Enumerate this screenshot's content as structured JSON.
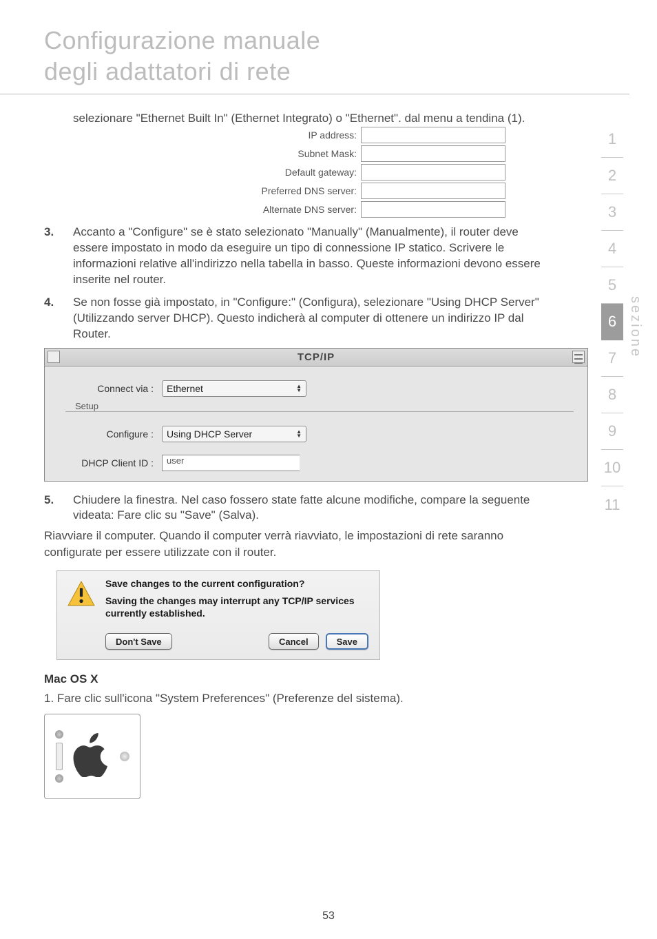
{
  "header": {
    "title_line1": "Configurazione manuale",
    "title_line2": "degli adattatori di rete"
  },
  "intro_paragraph": "selezionare \"Ethernet Built In\" (Ethernet Integrato) o \"Ethernet\". dal menu a tendina (1).",
  "ip_fields": {
    "ip_address": "IP address:",
    "subnet_mask": "Subnet Mask:",
    "default_gateway": "Default gateway:",
    "preferred_dns": "Preferred DNS server:",
    "alternate_dns": "Alternate DNS server:"
  },
  "step3": {
    "num": "3.",
    "text": "Accanto a \"Configure\" se è stato selezionato \"Manually\" (Manualmente), il router deve essere impostato in modo da eseguire un tipo di connessione IP statico. Scrivere le informazioni relative all'indirizzo nella tabella in basso. Queste informazioni devono essere inserite nel router."
  },
  "step4": {
    "num": "4.",
    "text": "Se non fosse già impostato, in \"Configure:\" (Configura), selezionare \"Using DHCP Server\" (Utilizzando server DHCP). Questo indicherà al computer di ottenere un indirizzo IP dal Router."
  },
  "tcpip": {
    "title": "TCP/IP",
    "setup_label": "Setup",
    "connect_via_label": "Connect via :",
    "connect_via_value": "Ethernet",
    "configure_label": "Configure :",
    "configure_value": "Using DHCP Server",
    "dhcp_client_id_label": "DHCP Client ID :",
    "dhcp_client_id_value": "user"
  },
  "step5": {
    "num": "5.",
    "text": "Chiudere la finestra. Nel caso fossero state fatte alcune modifiche, compare la seguente videata: Fare clic su \"Save\" (Salva)."
  },
  "restart_para": "Riavviare il computer. Quando il computer verrà riavviato, le impostazioni di rete saranno configurate per essere utilizzate con il router.",
  "dialog": {
    "line1": "Save changes to the current configuration?",
    "line2": "Saving the changes may interrupt any TCP/IP services currently established.",
    "dont_save": "Don't Save",
    "cancel": "Cancel",
    "save": "Save"
  },
  "macosx": {
    "heading": "Mac OS X",
    "step1": "1. Fare clic sull'icona \"System Preferences\" (Preferenze del sistema)."
  },
  "side": {
    "items": [
      "1",
      "2",
      "3",
      "4",
      "5",
      "6",
      "7",
      "8",
      "9",
      "10",
      "11"
    ],
    "active_index": 5,
    "label": "sezione"
  },
  "page_number": "53"
}
